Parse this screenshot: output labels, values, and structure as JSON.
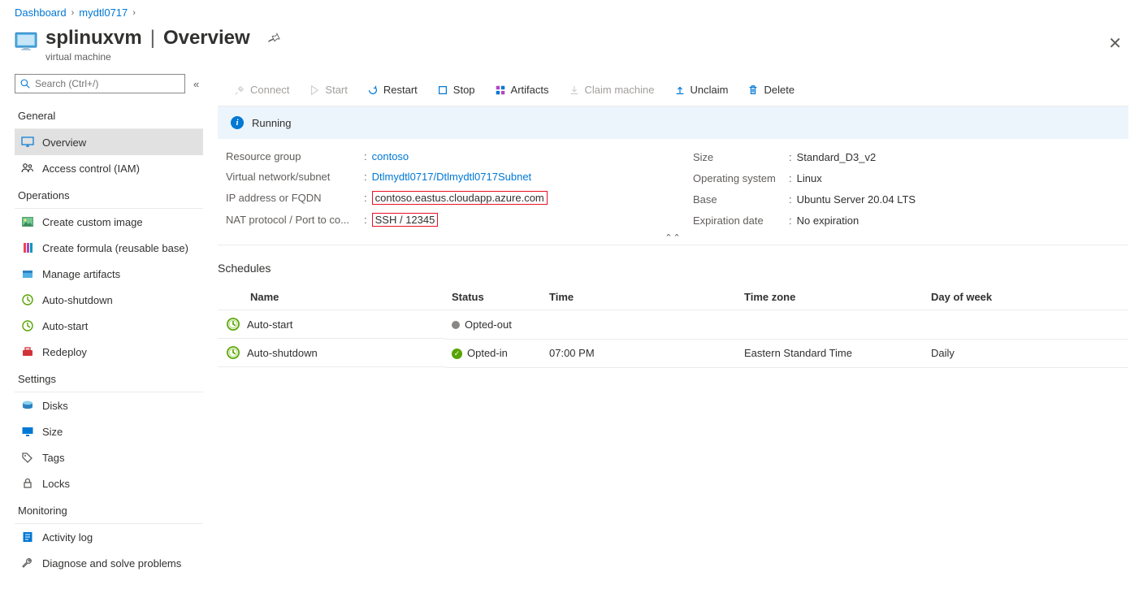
{
  "breadcrumb": {
    "dashboard": "Dashboard",
    "lab": "mydtl0717"
  },
  "header": {
    "title_resource": "splinuxvm",
    "title_page": "Overview",
    "subtitle": "virtual machine"
  },
  "search": {
    "placeholder": "Search (Ctrl+/)"
  },
  "nav": {
    "section_general": "General",
    "overview": "Overview",
    "access_control": "Access control (IAM)",
    "section_operations": "Operations",
    "create_custom_image": "Create custom image",
    "create_formula": "Create formula (reusable base)",
    "manage_artifacts": "Manage artifacts",
    "auto_shutdown": "Auto-shutdown",
    "auto_start": "Auto-start",
    "redeploy": "Redeploy",
    "section_settings": "Settings",
    "disks": "Disks",
    "size": "Size",
    "tags": "Tags",
    "locks": "Locks",
    "section_monitoring": "Monitoring",
    "activity_log": "Activity log",
    "diagnose": "Diagnose and solve problems"
  },
  "toolbar": {
    "connect": "Connect",
    "start": "Start",
    "restart": "Restart",
    "stop": "Stop",
    "artifacts": "Artifacts",
    "claim": "Claim machine",
    "unclaim": "Unclaim",
    "delete": "Delete"
  },
  "status": "Running",
  "properties": {
    "resource_group_label": "Resource group",
    "resource_group_value": "contoso",
    "vnet_label": "Virtual network/subnet",
    "vnet_value": "Dtlmydtl0717/Dtlmydtl0717Subnet",
    "ip_label": "IP address or FQDN",
    "ip_value": "contoso.eastus.cloudapp.azure.com",
    "nat_label": "NAT protocol / Port to co...",
    "nat_value": "SSH / 12345",
    "size_label": "Size",
    "size_value": "Standard_D3_v2",
    "os_label": "Operating system",
    "os_value": "Linux",
    "base_label": "Base",
    "base_value": "Ubuntu Server 20.04 LTS",
    "exp_label": "Expiration date",
    "exp_value": "No expiration"
  },
  "schedules": {
    "title": "Schedules",
    "col_name": "Name",
    "col_status": "Status",
    "col_time": "Time",
    "col_tz": "Time zone",
    "col_dow": "Day of week",
    "rows": [
      {
        "name": "Auto-start",
        "status": "Opted-out",
        "time": "",
        "tz": "",
        "dow": ""
      },
      {
        "name": "Auto-shutdown",
        "status": "Opted-in",
        "time": "07:00 PM",
        "tz": "Eastern Standard Time",
        "dow": "Daily"
      }
    ]
  }
}
